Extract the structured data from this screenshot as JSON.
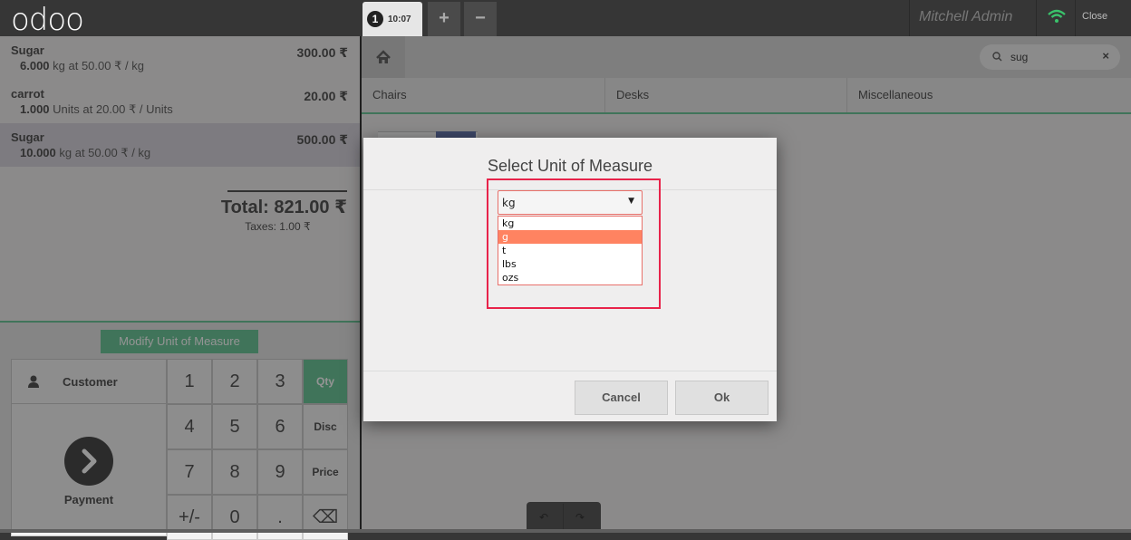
{
  "app": {
    "logo": "odoo"
  },
  "header": {
    "order_number": "1",
    "order_time": "10:07",
    "add_tab": "+",
    "remove_tab": "−",
    "user": "Mitchell Admin",
    "close": "Close"
  },
  "order": {
    "lines": [
      {
        "name": "Sugar",
        "price": "300.00 ₹",
        "qty": "6.000",
        "info": " kg at 50.00 ₹ / kg",
        "selected": false
      },
      {
        "name": "carrot",
        "price": "20.00 ₹",
        "qty": "1.000",
        "info": " Units at 20.00 ₹ / Units",
        "selected": false
      },
      {
        "name": "Sugar",
        "price": "500.00 ₹",
        "qty": "10.000",
        "info": " kg at 50.00 ₹ / kg",
        "selected": true
      }
    ],
    "total": "Total: 821.00 ₹",
    "taxes": "Taxes: 1.00 ₹"
  },
  "pads": {
    "modify_uom": "Modify Unit of Measure",
    "customer": "Customer",
    "payment": "Payment",
    "keys": [
      "1",
      "2",
      "3",
      "Qty",
      "4",
      "5",
      "6",
      "Disc",
      "7",
      "8",
      "9",
      "Price",
      "+/-",
      "0",
      ".",
      "⌫"
    ]
  },
  "products": {
    "search_value": "sug",
    "categories": [
      "Chairs",
      "Desks",
      "Miscellaneous"
    ]
  },
  "modal": {
    "title": "Select Unit of Measure",
    "selected": "kg",
    "options": [
      "kg",
      "g",
      "t",
      "lbs",
      "ozs"
    ],
    "highlighted_option": "g",
    "cancel": "Cancel",
    "ok": "Ok"
  },
  "colors": {
    "accent": "#6ec89b",
    "highlight_border": "#e8234a",
    "option_highlight": "#ff8361"
  }
}
